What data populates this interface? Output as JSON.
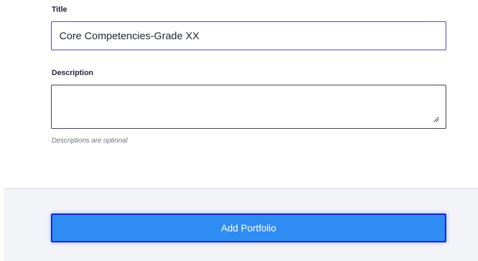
{
  "form": {
    "title_label": "Title",
    "title_value": "Core Competencies-Grade XX",
    "description_label": "Description",
    "description_value": "",
    "description_hint": "Descriptions are optional"
  },
  "footer": {
    "add_button_label": "Add Portfolio"
  },
  "colors": {
    "focus_border": "#4b45b8",
    "button_bg": "#2f8cf3",
    "button_border": "#1f1fc8",
    "footer_bg": "#f3f4f8"
  },
  "icons": {
    "resize": "resize-grip-icon"
  }
}
